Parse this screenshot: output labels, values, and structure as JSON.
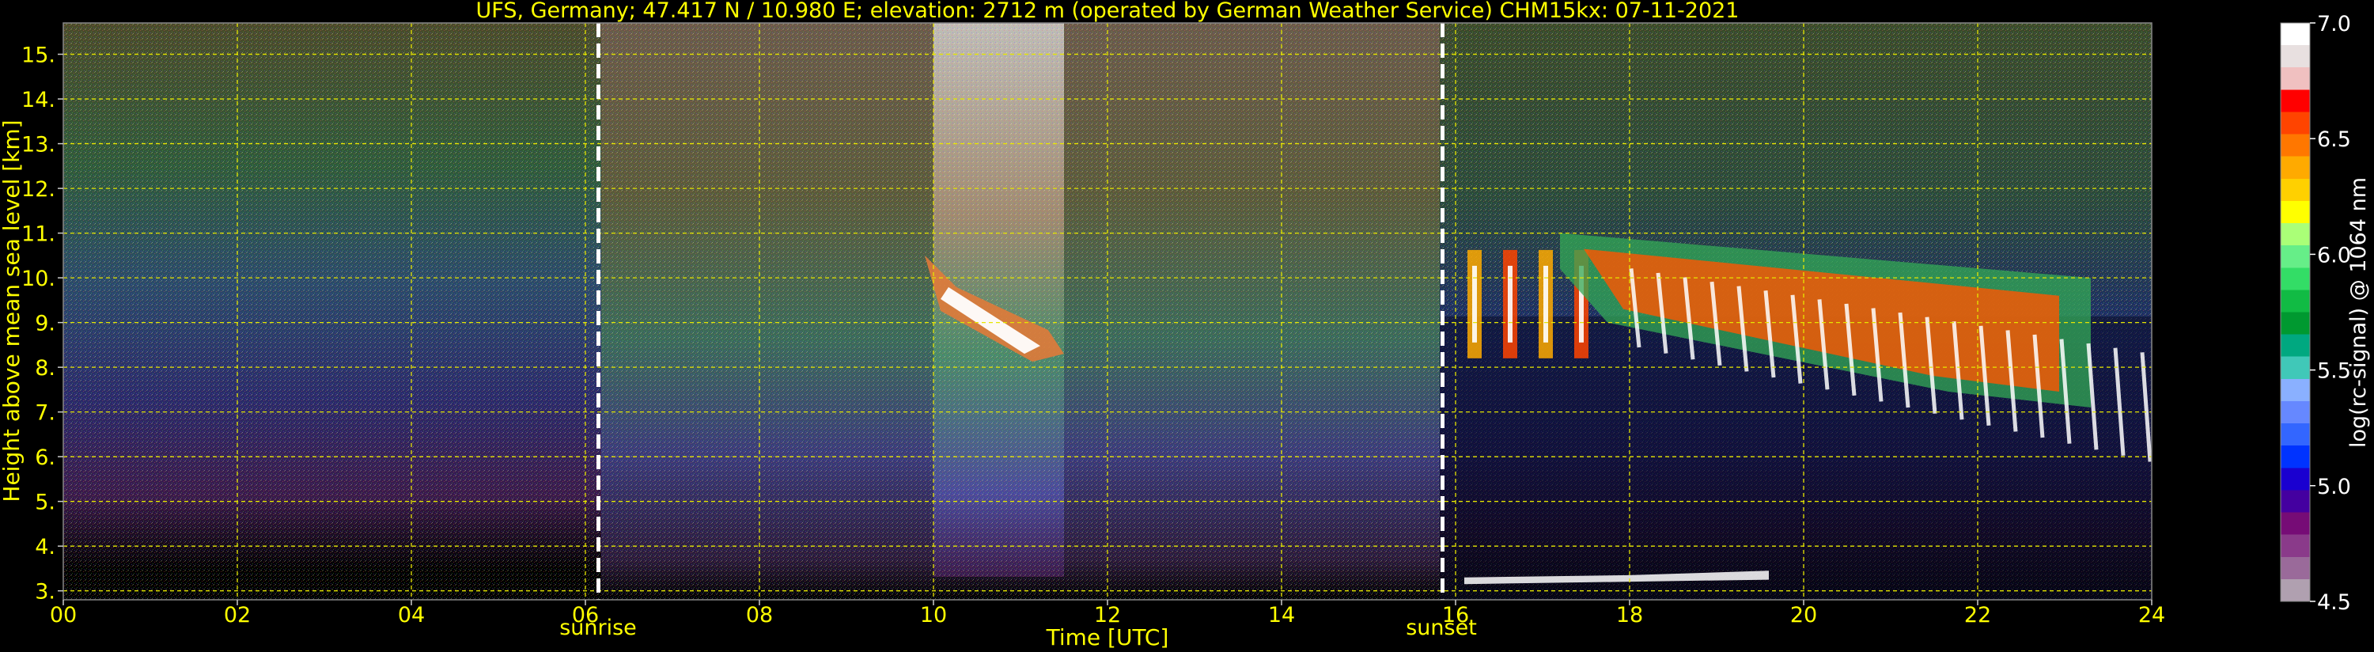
{
  "chart_data": {
    "type": "heatmap",
    "title": "UFS, Germany; 47.417 N / 10.980 E; elevation: 2712 m  (operated by German Weather Service)    CHM15kx: 07-11-2021",
    "xlabel": "Time [UTC]",
    "ylabel": "Height above mean sea level [km]",
    "xlim": [
      0,
      24
    ],
    "ylim": [
      2.8,
      15.7
    ],
    "x_ticks": [
      "00",
      "02",
      "04",
      "06",
      "08",
      "10",
      "12",
      "14",
      "16",
      "18",
      "20",
      "22",
      "24"
    ],
    "y_ticks": [
      "3.",
      "4.",
      "5.",
      "6.",
      "7.",
      "8.",
      "9.",
      "10.",
      "11.",
      "12.",
      "13.",
      "14.",
      "15."
    ],
    "grid": true,
    "markers": [
      {
        "label": "sunrise",
        "x": 6.15
      },
      {
        "label": "sunset",
        "x": 15.85
      }
    ],
    "colorbar": {
      "label": "log(rc-signal) @ 1064 nm",
      "min": 4.5,
      "max": 7.0,
      "ticks": [
        "4.5",
        "5.0",
        "5.5",
        "6.0",
        "6.5",
        "7.0"
      ],
      "colors": [
        "#b0a0b0",
        "#9a6a9a",
        "#8a3a8a",
        "#760c76",
        "#4400a0",
        "#1a00d0",
        "#0033ff",
        "#3366ff",
        "#6688ff",
        "#8ab0ff",
        "#40c8b8",
        "#00a880",
        "#009930",
        "#11bb44",
        "#33dd66",
        "#66ee88",
        "#aaff77",
        "#ffff00",
        "#ffd000",
        "#ffaa00",
        "#ff7700",
        "#ff4400",
        "#ff0000",
        "#f0c0c0",
        "#e8e0e0",
        "#ffffff"
      ]
    },
    "clouds": [
      {
        "layer": "cirrus",
        "t_start": 9.9,
        "t_end": 11.5,
        "h_bottom": 8.3,
        "h_top": 10.5
      },
      {
        "layer": "cirrus",
        "t_start": 16.0,
        "t_end": 17.2,
        "h_bottom": 8.2,
        "h_top": 10.8
      },
      {
        "layer": "cirrus",
        "t_start": 17.2,
        "t_end": 23.3,
        "h_bottom": 7.1,
        "h_top": 11.0
      }
    ]
  },
  "axes": {
    "title": "UFS, Germany; 47.417 N / 10.980 E; elevation: 2712 m  (operated by German Weather Service)    CHM15kx: 07-11-2021",
    "xlabel": "Time [UTC]",
    "ylabel": "Height above mean sea level [km]",
    "sunrise_label": "sunrise",
    "sunset_label": "sunset",
    "colorbar_label": "log(rc-signal) @ 1064 nm"
  }
}
